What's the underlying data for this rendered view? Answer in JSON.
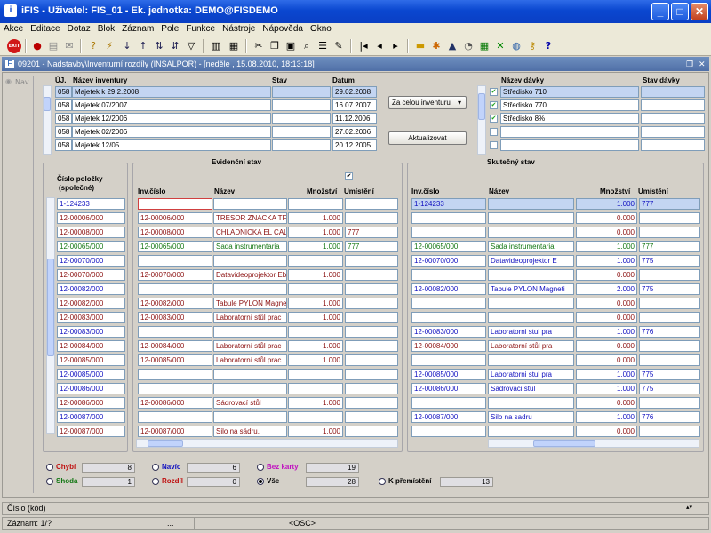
{
  "window": {
    "title": "iFIS - Uživatel: FIS_01 - Ek. jednotka: DEMO@FISDEMO"
  },
  "menu": [
    "Akce",
    "Editace",
    "Dotaz",
    "Blok",
    "Záznam",
    "Pole",
    "Funkce",
    "Nástroje",
    "Nápověda",
    "Okno"
  ],
  "toolbar": {
    "exit_label": "EXIT"
  },
  "form": {
    "title": "09201 - Nadstavby\\Inventurní rozdíly (INSALPOR) - [neděle , 15.08.2010, 18:13:18]",
    "nav_label": "Nav"
  },
  "inventory": {
    "headers": {
      "ul": "ÚJ.",
      "name": "Název inventury",
      "stav": "Stav",
      "datum": "Datum"
    },
    "rows": [
      {
        "ul": "058",
        "name": "Majetek k 29.2.2008",
        "stav": "",
        "datum": "29.02.2008",
        "selected": true
      },
      {
        "ul": "058",
        "name": "Majetek 07/2007",
        "stav": "",
        "datum": "16.07.2007"
      },
      {
        "ul": "058",
        "name": "Majetek 12/2006",
        "stav": "",
        "datum": "11.12.2006"
      },
      {
        "ul": "058",
        "name": "Majetek 02/2006",
        "stav": "",
        "datum": "27.02.2006"
      },
      {
        "ul": "058",
        "name": "Majetek 12/05",
        "stav": "",
        "datum": "20.12.2005"
      }
    ],
    "scope_select": "Za celou inventuru",
    "refresh_button": "Aktualizovat"
  },
  "batches": {
    "headers": {
      "name": "Název dávky",
      "stav": "Stav dávky"
    },
    "rows": [
      {
        "name": "Středisko 710",
        "checked": true,
        "selected": true
      },
      {
        "name": "Středisko 770",
        "checked": true
      },
      {
        "name": "Středisko 8%",
        "checked": true
      },
      {
        "name": "",
        "checked": false
      },
      {
        "name": "",
        "checked": false
      }
    ]
  },
  "items": {
    "header_line1": "Číslo položky",
    "header_line2": "(společné)"
  },
  "evidence": {
    "title": "Evidenční stav",
    "headers": {
      "inv": "Inv.číslo",
      "name": "Název",
      "qty": "Množství",
      "loc": "Umístění"
    }
  },
  "actual": {
    "title": "Skutečný stav",
    "headers": {
      "inv": "Inv.číslo",
      "name": "Název",
      "qty": "Množství",
      "loc": "Umístění"
    }
  },
  "rows": [
    {
      "item": "1-124233",
      "color": "#1010c0",
      "e_inv": "",
      "e_name": "",
      "e_qty": "",
      "e_loc": "",
      "a_inv": "1-124233",
      "a_name": "",
      "a_qty": "1.000",
      "a_loc": "777",
      "selected": true
    },
    {
      "item": "12-00006/000",
      "color": "#8b1010",
      "e_inv": "12-00006/000",
      "e_name": "TRESOR ZNACKA TF",
      "e_qty": "1.000",
      "e_loc": "",
      "a_inv": "",
      "a_name": "",
      "a_qty": "0.000",
      "a_loc": ""
    },
    {
      "item": "12-00008/000",
      "color": "#8b1010",
      "e_inv": "12-00008/000",
      "e_name": "CHLADNICKA EL CAL",
      "e_qty": "1.000",
      "e_loc": "777",
      "a_inv": "",
      "a_name": "",
      "a_qty": "0.000",
      "a_loc": ""
    },
    {
      "item": "12-00065/000",
      "color": "#137713",
      "e_inv": "12-00065/000",
      "e_name": "Sada instrumentaria",
      "e_qty": "1.000",
      "e_loc": "777",
      "a_inv": "12-00065/000",
      "a_name": "Sada instrumentaria",
      "a_qty": "1.000",
      "a_loc": "777"
    },
    {
      "item": "12-00070/000",
      "color": "#1010c0",
      "e_inv": "",
      "e_name": "",
      "e_qty": "",
      "e_loc": "",
      "a_inv": "12-00070/000",
      "a_name": "Datavideoprojektor E",
      "a_qty": "1.000",
      "a_loc": "775"
    },
    {
      "item": "12-00070/000",
      "color": "#8b1010",
      "e_inv": "12-00070/000",
      "e_name": "Datavideoprojektor Eb",
      "e_qty": "1.000",
      "e_loc": "",
      "a_inv": "",
      "a_name": "",
      "a_qty": "0.000",
      "a_loc": ""
    },
    {
      "item": "12-00082/000",
      "color": "#1010c0",
      "e_inv": "",
      "e_name": "",
      "e_qty": "",
      "e_loc": "",
      "a_inv": "12-00082/000",
      "a_name": "Tabule PYLON Magneti",
      "a_qty": "2.000",
      "a_loc": "775"
    },
    {
      "item": "12-00082/000",
      "color": "#8b1010",
      "e_inv": "12-00082/000",
      "e_name": "Tabule PYLON Magne",
      "e_qty": "1.000",
      "e_loc": "",
      "a_inv": "",
      "a_name": "",
      "a_qty": "0.000",
      "a_loc": ""
    },
    {
      "item": "12-00083/000",
      "color": "#8b1010",
      "e_inv": "12-00083/000",
      "e_name": "Laboratorní stůl prac",
      "e_qty": "1.000",
      "e_loc": "",
      "a_inv": "",
      "a_name": "",
      "a_qty": "0.000",
      "a_loc": ""
    },
    {
      "item": "12-00083/000",
      "color": "#1010c0",
      "e_inv": "",
      "e_name": "",
      "e_qty": "",
      "e_loc": "",
      "a_inv": "12-00083/000",
      "a_name": "Laboratorni stul pra",
      "a_qty": "1.000",
      "a_loc": "776"
    },
    {
      "item": "12-00084/000",
      "color": "#8b1010",
      "e_inv": "12-00084/000",
      "e_name": "Laboratorní stůl prac",
      "e_qty": "1.000",
      "e_loc": "",
      "a_inv": "12-00084/000",
      "a_name": "Laboratorní stůl pra",
      "a_qty": "0.000",
      "a_loc": ""
    },
    {
      "item": "12-00085/000",
      "color": "#8b1010",
      "e_inv": "12-00085/000",
      "e_name": "Laboratorní stůl prac",
      "e_qty": "1.000",
      "e_loc": "",
      "a_inv": "",
      "a_name": "",
      "a_qty": "0.000",
      "a_loc": ""
    },
    {
      "item": "12-00085/000",
      "color": "#1010c0",
      "e_inv": "",
      "e_name": "",
      "e_qty": "",
      "e_loc": "",
      "a_inv": "12-00085/000",
      "a_name": "Laboratorni stul pra",
      "a_qty": "1.000",
      "a_loc": "775"
    },
    {
      "item": "12-00086/000",
      "color": "#1010c0",
      "e_inv": "",
      "e_name": "",
      "e_qty": "",
      "e_loc": "",
      "a_inv": "12-00086/000",
      "a_name": "Sadrovaci stul",
      "a_qty": "1.000",
      "a_loc": "775"
    },
    {
      "item": "12-00086/000",
      "color": "#8b1010",
      "e_inv": "12-00086/000",
      "e_name": "Sádrovací stůl",
      "e_qty": "1.000",
      "e_loc": "",
      "a_inv": "",
      "a_name": "",
      "a_qty": "0.000",
      "a_loc": ""
    },
    {
      "item": "12-00087/000",
      "color": "#1010c0",
      "e_inv": "",
      "e_name": "",
      "e_qty": "",
      "e_loc": "",
      "a_inv": "12-00087/000",
      "a_name": "Silo na sadru",
      "a_qty": "1.000",
      "a_loc": "776"
    },
    {
      "item": "12-00087/000",
      "color": "#8b1010",
      "e_inv": "12-00087/000",
      "e_name": "Silo na sádru.",
      "e_qty": "1.000",
      "e_loc": "",
      "a_inv": "",
      "a_name": "",
      "a_qty": "0.000",
      "a_loc": ""
    }
  ],
  "summary": {
    "chybi": {
      "label": "Chybí",
      "count": "8",
      "color": "#c01010"
    },
    "navic": {
      "label": "Navíc",
      "count": "6",
      "color": "#1010c0"
    },
    "bezkarty": {
      "label": "Bez karty",
      "count": "19",
      "color": "#c010c0"
    },
    "shoda": {
      "label": "Shoda",
      "count": "1",
      "color": "#137713"
    },
    "rozdil": {
      "label": "Rozdíl",
      "count": "0",
      "color": "#c01010"
    },
    "vse": {
      "label": "Vše",
      "count": "28",
      "color": "#000000"
    },
    "kpremisteni": {
      "label": "K přemístění",
      "count": "13",
      "color": "#000000"
    }
  },
  "status": {
    "field": "Číslo (kód)",
    "record": "Záznam: 1/?",
    "dots": "...",
    "osc": "<OSC>"
  }
}
